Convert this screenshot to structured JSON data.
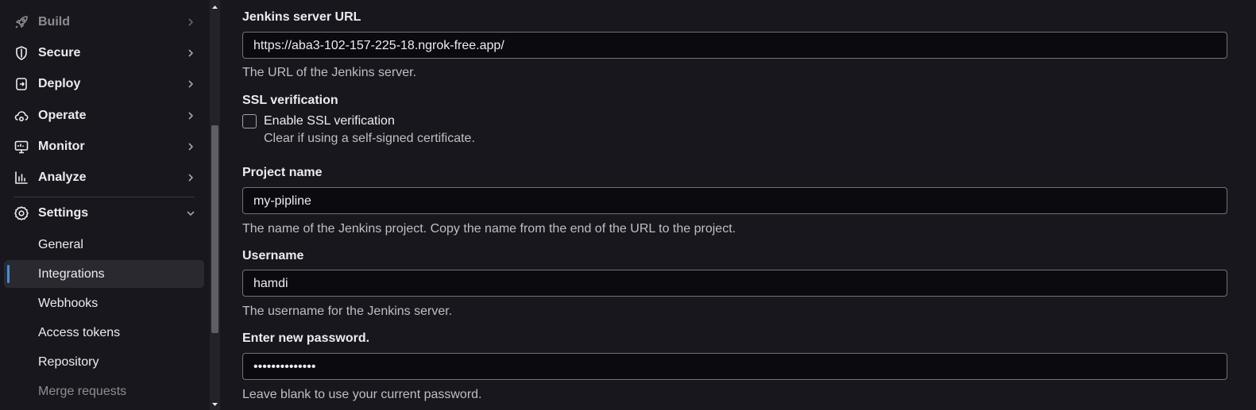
{
  "sidebar": {
    "items": [
      {
        "label": "Build",
        "icon": "rocket-icon"
      },
      {
        "label": "Secure",
        "icon": "shield-icon"
      },
      {
        "label": "Deploy",
        "icon": "deployments-icon"
      },
      {
        "label": "Operate",
        "icon": "cloud-gear-icon"
      },
      {
        "label": "Monitor",
        "icon": "monitor-icon"
      },
      {
        "label": "Analyze",
        "icon": "chart-icon"
      }
    ],
    "settings": {
      "label": "Settings",
      "icon": "gear-icon"
    },
    "sub_items": [
      {
        "label": "General"
      },
      {
        "label": "Integrations",
        "active": true
      },
      {
        "label": "Webhooks"
      },
      {
        "label": "Access tokens"
      },
      {
        "label": "Repository"
      },
      {
        "label": "Merge requests"
      }
    ]
  },
  "form": {
    "jenkins_url": {
      "label": "Jenkins server URL",
      "value": "https://aba3-102-157-225-18.ngrok-free.app/",
      "help": "The URL of the Jenkins server."
    },
    "ssl": {
      "label": "SSL verification",
      "checkbox_label": "Enable SSL verification",
      "checked": false,
      "help": "Clear if using a self-signed certificate."
    },
    "project_name": {
      "label": "Project name",
      "value": "my-pipline",
      "help": "The name of the Jenkins project. Copy the name from the end of the URL to the project."
    },
    "username": {
      "label": "Username",
      "value": "hamdi",
      "help": "The username for the Jenkins server."
    },
    "password": {
      "label": "Enter new password.",
      "value": "••••••••••••••",
      "help": "Leave blank to use your current password."
    }
  },
  "colors": {
    "background": "#18171d",
    "input_background": "#0b0a0f",
    "active_indicator": "#428fdc",
    "text": "#ececef",
    "muted_text": "#bfbfc3"
  }
}
